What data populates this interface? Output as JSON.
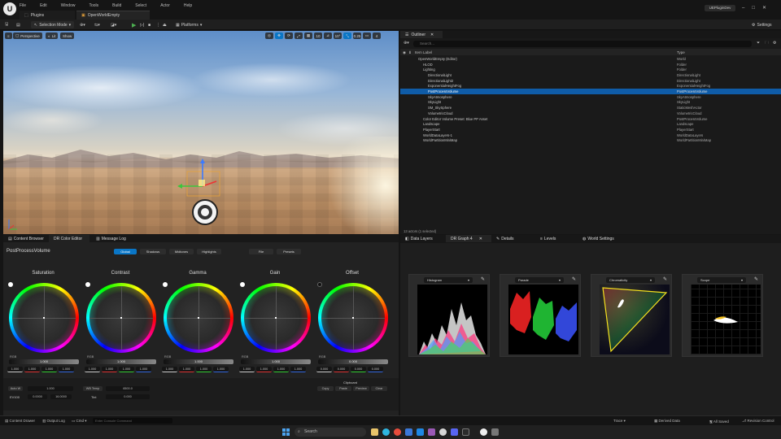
{
  "titlebar": {
    "logo": "U",
    "menu": [
      "File",
      "Edit",
      "Window",
      "Tools",
      "Build",
      "Select",
      "Actor",
      "Help"
    ],
    "tabs": [
      {
        "label": "Plugins"
      },
      {
        "label": "OpenWorldEmpty"
      }
    ],
    "project": "UEPluginDev",
    "window_controls": [
      "–",
      "□",
      "✕"
    ]
  },
  "toolbar": {
    "mode": "Selection Mode",
    "platforms": "Platforms",
    "settings": "Settings"
  },
  "viewport": {
    "perspective": "Perspective",
    "lit": "Lit",
    "show": "Show",
    "right_icons": [
      "◎",
      "✥",
      "⟳",
      "⤢",
      "▦",
      "10",
      "⊿",
      "10°",
      "⤡",
      "0.25",
      "▭",
      "4"
    ]
  },
  "outliner": {
    "tab": "Outliner",
    "search_placeholder": "Search...",
    "col_label": "Item Label",
    "col_type": "Type",
    "rows": [
      {
        "label": "OpenWorldEmpty (Editor)",
        "type": "World",
        "indent": 0
      },
      {
        "label": "HLOD",
        "type": "Folder",
        "indent": 1
      },
      {
        "label": "Lighting",
        "type": "Folder",
        "indent": 1
      },
      {
        "label": "DirectionalLight",
        "type": "DirectionalLight",
        "indent": 2
      },
      {
        "label": "DirectionalLight2",
        "type": "DirectionalLight",
        "indent": 2
      },
      {
        "label": "ExponentialHeightFog",
        "type": "ExponentialHeightFog",
        "indent": 2
      },
      {
        "label": "PostProcessVolume",
        "type": "PostProcessVolume",
        "indent": 2,
        "selected": true
      },
      {
        "label": "SkyAtmosphere",
        "type": "SkyAtmosphere",
        "indent": 2
      },
      {
        "label": "SkyLight",
        "type": "SkyLight",
        "indent": 2
      },
      {
        "label": "SM_SkySphere",
        "type": "StaticMeshActor",
        "indent": 2
      },
      {
        "label": "VolumetricCloud",
        "type": "VolumetricCloud",
        "indent": 2
      },
      {
        "label": "Color Editor Volume Preset: Blue PP Asset",
        "type": "PostProcessVolume",
        "indent": 1
      },
      {
        "label": "Landscape",
        "type": "Landscape",
        "indent": 1
      },
      {
        "label": "PlayerStart",
        "type": "PlayerStart",
        "indent": 1
      },
      {
        "label": "WorldDataLayers-1",
        "type": "WorldDataLayers",
        "indent": 1
      },
      {
        "label": "WorldPartitionMiniMap",
        "type": "WorldPartitionMiniMap",
        "indent": 1
      }
    ],
    "footer": "13 actors (1 selected)"
  },
  "bottom_tabs": [
    "Content Browser",
    "DR Color Editor",
    "Message Log"
  ],
  "color_editor": {
    "title": "PostProcessVolume",
    "modes": [
      "Global",
      "Shadows",
      "Midtones",
      "Highlights"
    ],
    "file": "File",
    "presets": "Presets",
    "wheels": [
      {
        "label": "Saturation",
        "slider": "1.000",
        "vals": [
          "1.000",
          "1.000",
          "1.000",
          "1.000"
        ]
      },
      {
        "label": "Contrast",
        "slider": "1.000",
        "vals": [
          "1.000",
          "1.000",
          "1.000",
          "1.000"
        ]
      },
      {
        "label": "Gamma",
        "slider": "1.000",
        "vals": [
          "1.000",
          "1.000",
          "1.000",
          "1.000"
        ]
      },
      {
        "label": "Gain",
        "slider": "1.000",
        "vals": [
          "1.000",
          "1.000",
          "1.000",
          "1.000"
        ]
      },
      {
        "label": "Offset",
        "slider": "0.000",
        "vals": [
          "0.000",
          "0.000",
          "0.000",
          "0.000"
        ]
      }
    ],
    "rgb": "RGB",
    "bottom": {
      "auto_wb": "Auto W",
      "auto_val": "1.000",
      "wb_temp": "WB Temp",
      "wb_temp_val": "6500.0",
      "tint": "Tint",
      "tint_val": "0.000",
      "ev100": "EV100",
      "ev_a": "0.0000",
      "ev_b": "16.0000",
      "clipboard": "Clipboard",
      "clip_btns": [
        "Copy",
        "Paste",
        "Preview",
        "Clear"
      ]
    }
  },
  "scopes": {
    "tabs": [
      "Data Layers",
      "DR Graph 4",
      "Details",
      "Levels",
      "World Settings"
    ],
    "panels": [
      {
        "label": "Histogram"
      },
      {
        "label": "Parade"
      },
      {
        "label": "Chromaticity"
      },
      {
        "label": "Scope"
      }
    ]
  },
  "statusbar": {
    "content_drawer": "Content Drawer",
    "output_log": "Output Log",
    "cmd": "Cmd",
    "cmd_placeholder": "Enter Console Command",
    "trace": "Trace",
    "derived": "Derived Data",
    "saved": "All Saved",
    "revision": "Revision Control"
  },
  "taskbar": {
    "search": "Search"
  }
}
